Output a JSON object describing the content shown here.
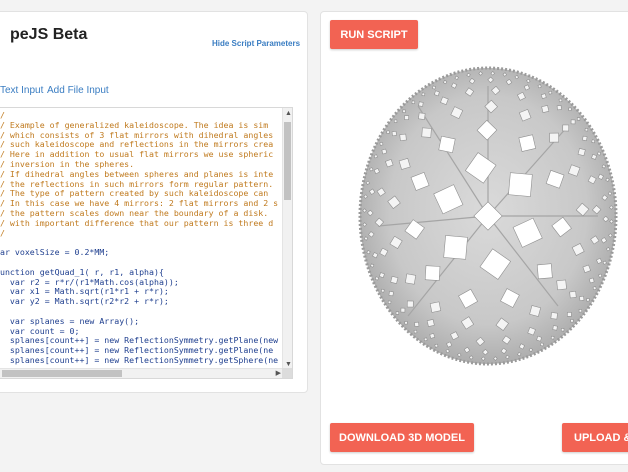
{
  "app": {
    "title": "peJS Beta",
    "hide_params_label": "Hide Script Parameters"
  },
  "tabs": [
    {
      "label": "Text Input"
    },
    {
      "label": "Add File Input"
    }
  ],
  "editor": {
    "lines": [
      "/",
      "/ Example of generalized kaleidoscope. The idea is sim",
      "/ which consists of 3 flat mirrors with dihedral angles",
      "/ such kaleidoscope and reflections in the mirrors crea",
      "/ Here in addition to usual flat mirrors we use spheric",
      "/ inversion in the spheres.",
      "/ If dihedral angles between spheres and planes is inte",
      "/ the reflections in such mirrors form regular pattern.",
      "/ The type of pattern created by such kaleidoscope can",
      "/ In this case we have 4 mirrors: 2 flat mirrors and 2 s",
      "/ the pattern scales down near the boundary of a disk.",
      "/ with important difference that our pattern is three d",
      "/",
      "",
      "ar voxelSize = 0.2*MM;",
      "",
      "unction getQuad_1( r, r1, alpha){",
      "  var r2 = r*r/(r1*Math.cos(alpha));",
      "  var x1 = Math.sqrt(r1*r1 + r*r);",
      "  var y2 = Math.sqrt(r2*r2 + r*r);",
      "",
      "  var splanes = new Array();",
      "  var count = 0;",
      "  splanes[count++] = new ReflectionSymmetry.getPlane(new",
      "  splanes[count++] = new ReflectionSymmetry.getPlane(ne",
      "  splanes[count++] = new ReflectionSymmetry.getSphere(ne",
      "  splanes[count++] = new ReflectionSymmetry.getSphere(ne"
    ]
  },
  "buttons": {
    "run": "RUN SCRIPT",
    "download": "DOWNLOAD 3D MODEL",
    "upload": "UPLOAD &"
  },
  "colors": {
    "button": "#f26353",
    "code_comment": "#c07a1e",
    "code_default": "#1f3f8f",
    "link": "#3a7dc2"
  },
  "icons": {
    "scroll_up": "triangle-up",
    "scroll_down": "triangle-down",
    "scroll_left": "triangle-left",
    "scroll_right": "triangle-right"
  }
}
